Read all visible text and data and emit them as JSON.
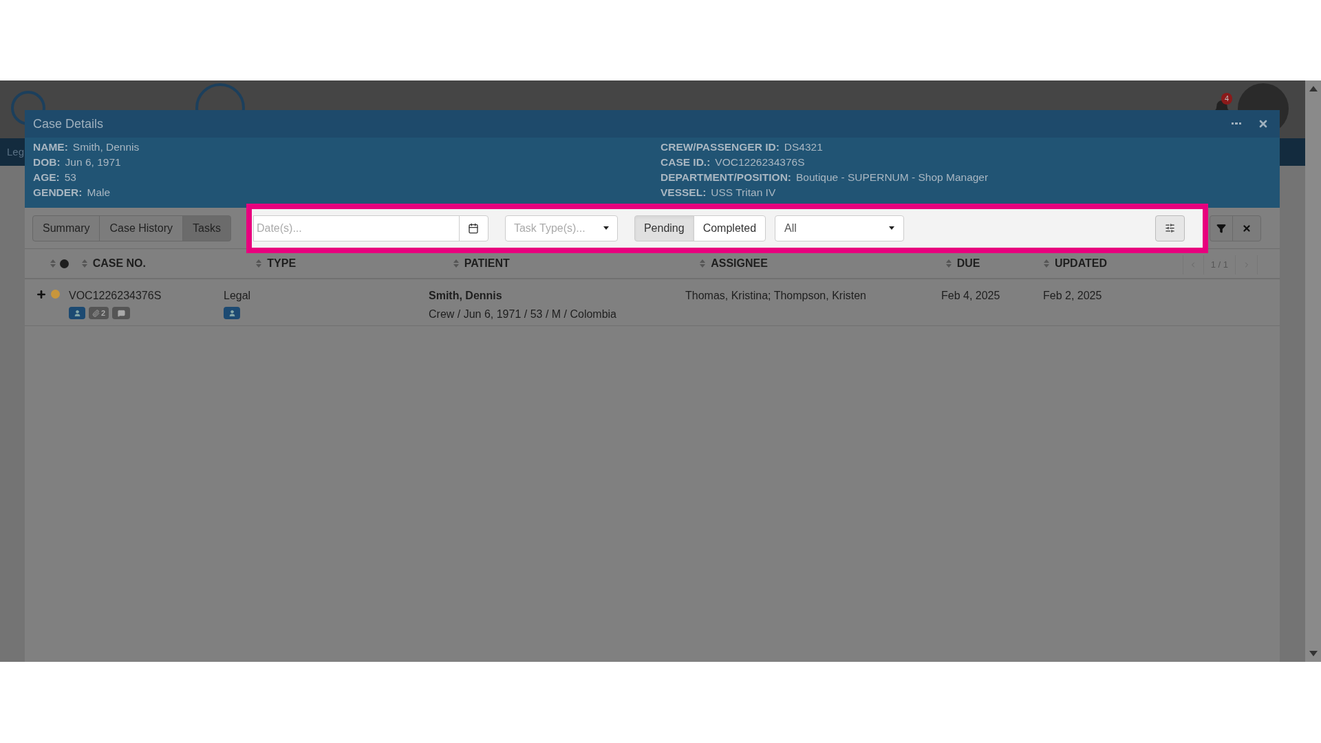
{
  "app": {
    "nav_item": "Leg",
    "notifications": "4"
  },
  "modal": {
    "title": "Case Details",
    "fields_left": [
      {
        "label": "NAME:",
        "value": "Smith, Dennis"
      },
      {
        "label": "DOB:",
        "value": "Jun 6, 1971"
      },
      {
        "label": "AGE:",
        "value": "53"
      },
      {
        "label": "GENDER:",
        "value": "Male"
      }
    ],
    "fields_right": [
      {
        "label": "CREW/PASSENGER ID:",
        "value": "DS4321"
      },
      {
        "label": "CASE ID.:",
        "value": "VOC1226234376S"
      },
      {
        "label": "DEPARTMENT/POSITION:",
        "value": "Boutique - SUPERNUM - Shop Manager"
      },
      {
        "label": "VESSEL:",
        "value": "USS Tritan IV"
      }
    ]
  },
  "tabs": [
    {
      "label": "Summary",
      "selected": false
    },
    {
      "label": "Case History",
      "selected": false
    },
    {
      "label": "Tasks",
      "selected": true
    }
  ],
  "filters": {
    "date": {
      "placeholder": "Date(s)..."
    },
    "task_type": {
      "placeholder": "Task Type(s)..."
    },
    "status": [
      {
        "label": "Pending",
        "selected": true
      },
      {
        "label": "Completed",
        "selected": false
      }
    ],
    "scope": {
      "value": "All"
    }
  },
  "table": {
    "columns": [
      "CASE NO.",
      "TYPE",
      "PATIENT",
      "ASSIGNEE",
      "DUE",
      "UPDATED"
    ],
    "pager": "1 / 1",
    "rows": [
      {
        "case_no": "VOC1226234376S",
        "color": "#c8963c",
        "badges": [
          {
            "kind": "person"
          },
          {
            "kind": "attachment",
            "count": "2"
          },
          {
            "kind": "comment"
          }
        ],
        "type": "Legal",
        "type_badges": [
          {
            "kind": "person"
          }
        ],
        "patient_name": "Smith, Dennis",
        "patient_details": "Crew / Jun 6, 1971 / 53 / M / Colombia",
        "assignee": "Thomas, Kristina; Thompson, Kristen",
        "due": "Feb 4, 2025",
        "updated": "Feb 2, 2025"
      }
    ]
  }
}
